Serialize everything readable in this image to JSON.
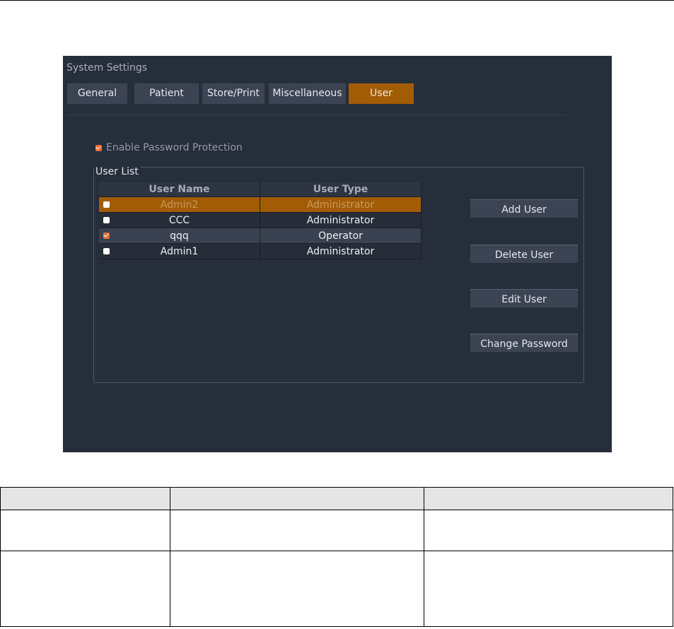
{
  "window": {
    "title": "System Settings"
  },
  "tabs": [
    {
      "label": "General",
      "active": false
    },
    {
      "label": "Patient",
      "active": false
    },
    {
      "label": "Store/Print",
      "active": false
    },
    {
      "label": "Miscellaneous",
      "active": false
    },
    {
      "label": "User",
      "active": true
    }
  ],
  "password_protection": {
    "label": "Enable Password Protection",
    "checked": true
  },
  "user_list": {
    "label": "User List",
    "columns": [
      "User Name",
      "User Type"
    ],
    "rows": [
      {
        "name": "Admin2",
        "type": "Administrator",
        "checked": false,
        "selected": true
      },
      {
        "name": "CCC",
        "type": "Administrator",
        "checked": false,
        "selected": false
      },
      {
        "name": "qqq",
        "type": "Operator",
        "checked": true,
        "selected": false
      },
      {
        "name": "Admin1",
        "type": "Administrator",
        "checked": false,
        "selected": false
      }
    ]
  },
  "actions": {
    "add_user": "Add User",
    "delete_user": "Delete User",
    "edit_user": "Edit User",
    "change_password": "Change Password"
  },
  "colors": {
    "panel_bg": "#272e3b",
    "accent": "#a35c06",
    "checkbox_on": "#e2703d"
  }
}
